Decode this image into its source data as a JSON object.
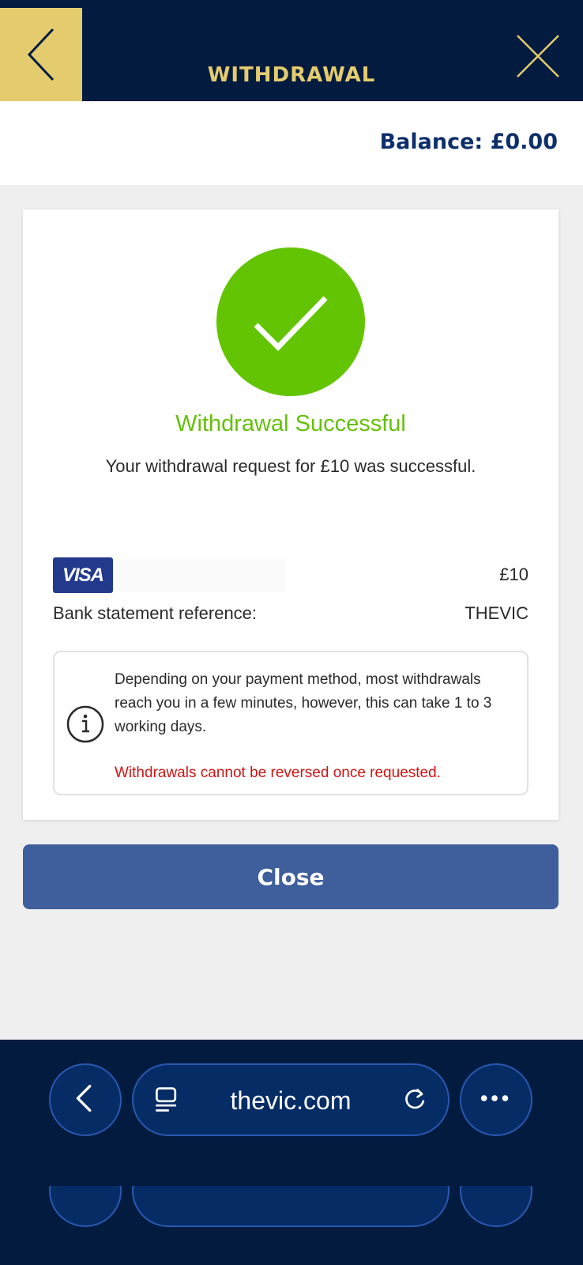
{
  "header": {
    "title": "WITHDRAWAL",
    "back_icon": "chevron-left-icon",
    "close_icon": "close-icon",
    "accent_color": "#e4cc6e",
    "background_color": "#021b3f"
  },
  "balance": {
    "label": "Balance: £0.00"
  },
  "result": {
    "icon": "checkmark-icon",
    "title": "Withdrawal Successful",
    "message": "Your withdrawal request for £10 was successful.",
    "success_color": "#63c404"
  },
  "payment": {
    "card_brand": "VISA",
    "amount": "£10",
    "reference_label": "Bank statement reference:",
    "reference_value": "THEVIC"
  },
  "info": {
    "icon": "info-icon",
    "text": "Depending on your payment method, most withdrawals reach you in a few minutes, however, this can take 1 to 3 working days.",
    "warning": "Withdrawals cannot be reversed once requested.",
    "warning_color": "#d01313"
  },
  "actions": {
    "close_label": "Close",
    "button_color": "#3e5e9c"
  },
  "browser": {
    "url": "thevic.com",
    "back_icon": "chevron-left-icon",
    "tabs_icon": "tabs-icon",
    "reload_icon": "reload-icon",
    "more_icon": "more-icon"
  }
}
